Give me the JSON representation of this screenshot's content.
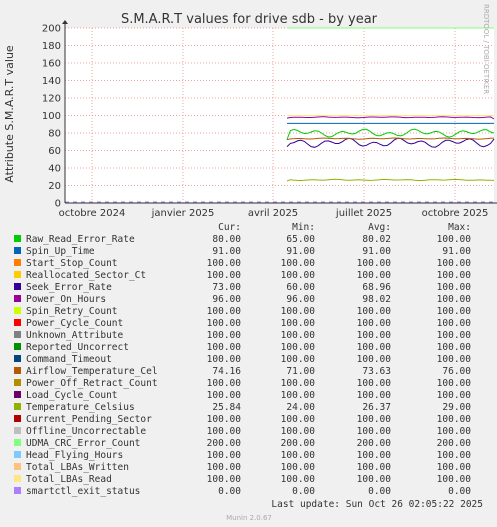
{
  "chart_data": {
    "type": "line",
    "title": "S.M.A.R.T values for drive sdb - by year",
    "ylabel": "Attribute S.M.A.R.T value",
    "ylim": [
      0,
      200
    ],
    "yticks": [
      0,
      20,
      40,
      60,
      80,
      100,
      120,
      140,
      160,
      180,
      200
    ],
    "xticks": [
      "octobre 2024",
      "janvier 2025",
      "avril 2025",
      "juillet 2025",
      "octobre 2025"
    ],
    "grid": true,
    "watermark": "RRDTOOL / TOBI OETIKER",
    "columns": [
      "Cur:",
      "Min:",
      "Avg:",
      "Max:"
    ],
    "series": [
      {
        "name": "Raw_Read_Error_Rate",
        "color": "#00cc00",
        "cur": "80.00",
        "min": "65.00",
        "avg": "80.02",
        "max": "100.00"
      },
      {
        "name": "Spin_Up_Time",
        "color": "#0066b3",
        "cur": "91.00",
        "min": "91.00",
        "avg": "91.00",
        "max": "91.00"
      },
      {
        "name": "Start_Stop_Count",
        "color": "#ff8000",
        "cur": "100.00",
        "min": "100.00",
        "avg": "100.00",
        "max": "100.00"
      },
      {
        "name": "Reallocated_Sector_Ct",
        "color": "#ffcc00",
        "cur": "100.00",
        "min": "100.00",
        "avg": "100.00",
        "max": "100.00"
      },
      {
        "name": "Seek_Error_Rate",
        "color": "#330099",
        "cur": "73.00",
        "min": "60.00",
        "avg": "68.96",
        "max": "100.00"
      },
      {
        "name": "Power_On_Hours",
        "color": "#990099",
        "cur": "96.00",
        "min": "96.00",
        "avg": "98.02",
        "max": "100.00"
      },
      {
        "name": "Spin_Retry_Count",
        "color": "#ccff00",
        "cur": "100.00",
        "min": "100.00",
        "avg": "100.00",
        "max": "100.00"
      },
      {
        "name": "Power_Cycle_Count",
        "color": "#ff0000",
        "cur": "100.00",
        "min": "100.00",
        "avg": "100.00",
        "max": "100.00"
      },
      {
        "name": "Unknown_Attribute",
        "color": "#808080",
        "cur": "100.00",
        "min": "100.00",
        "avg": "100.00",
        "max": "100.00"
      },
      {
        "name": "Reported_Uncorrect",
        "color": "#008f00",
        "cur": "100.00",
        "min": "100.00",
        "avg": "100.00",
        "max": "100.00"
      },
      {
        "name": "Command_Timeout",
        "color": "#00487d",
        "cur": "100.00",
        "min": "100.00",
        "avg": "100.00",
        "max": "100.00"
      },
      {
        "name": "Airflow_Temperature_Cel",
        "color": "#b35a00",
        "cur": "74.16",
        "min": "71.00",
        "avg": "73.63",
        "max": "76.00"
      },
      {
        "name": "Power_Off_Retract_Count",
        "color": "#b38f00",
        "cur": "100.00",
        "min": "100.00",
        "avg": "100.00",
        "max": "100.00"
      },
      {
        "name": "Load_Cycle_Count",
        "color": "#6b006b",
        "cur": "100.00",
        "min": "100.00",
        "avg": "100.00",
        "max": "100.00"
      },
      {
        "name": "Temperature_Celsius",
        "color": "#8fb300",
        "cur": "25.84",
        "min": "24.00",
        "avg": "26.37",
        "max": "29.00"
      },
      {
        "name": "Current_Pending_Sector",
        "color": "#b30000",
        "cur": "100.00",
        "min": "100.00",
        "avg": "100.00",
        "max": "100.00"
      },
      {
        "name": "Offline_Uncorrectable",
        "color": "#bebebe",
        "cur": "100.00",
        "min": "100.00",
        "avg": "100.00",
        "max": "100.00"
      },
      {
        "name": "UDMA_CRC_Error_Count",
        "color": "#80ff80",
        "cur": "200.00",
        "min": "200.00",
        "avg": "200.00",
        "max": "200.00"
      },
      {
        "name": "Head_Flying_Hours",
        "color": "#80c9ff",
        "cur": "100.00",
        "min": "100.00",
        "avg": "100.00",
        "max": "100.00"
      },
      {
        "name": "Total_LBAs_Written",
        "color": "#ffc080",
        "cur": "100.00",
        "min": "100.00",
        "avg": "100.00",
        "max": "100.00"
      },
      {
        "name": "Total_LBAs_Read",
        "color": "#ffe680",
        "cur": "100.00",
        "min": "100.00",
        "avg": "100.00",
        "max": "100.00"
      },
      {
        "name": "smartctl_exit_status",
        "color": "#aa80ff",
        "cur": "0.00",
        "min": "0.00",
        "avg": "0.00",
        "max": "0.00"
      }
    ],
    "last_update": "Last update: Sun Oct 26 02:05:22 2025",
    "footer": "Munin 2.0.67"
  }
}
